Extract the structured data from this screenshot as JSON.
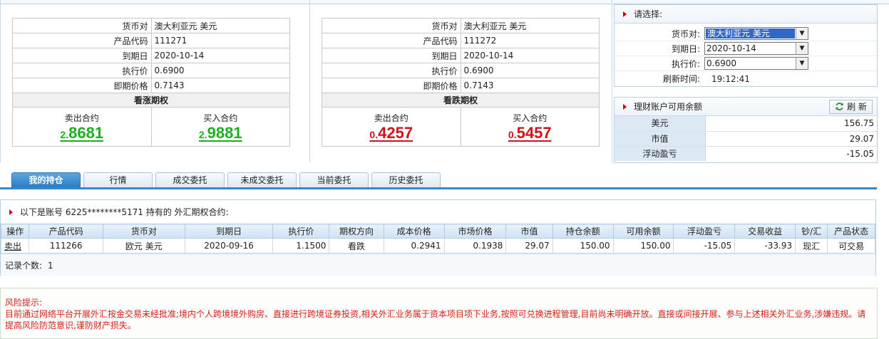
{
  "call_quote": {
    "rows": [
      {
        "label": "货币对",
        "value": "澳大利亚元 美元"
      },
      {
        "label": "产品代码",
        "value": "111271"
      },
      {
        "label": "到期日",
        "value": "2020-10-14"
      },
      {
        "label": "执行价",
        "value": "0.6900"
      },
      {
        "label": "即期价格",
        "value": "0.7143"
      }
    ],
    "header": "看涨期权",
    "sell_label": "卖出合约",
    "sell_prefix": "2.",
    "sell_price": "8681",
    "buy_label": "买入合约",
    "buy_prefix": "2.",
    "buy_price": "9881"
  },
  "put_quote": {
    "rows": [
      {
        "label": "货币对",
        "value": "澳大利亚元 美元"
      },
      {
        "label": "产品代码",
        "value": "111272"
      },
      {
        "label": "到期日",
        "value": "2020-10-14"
      },
      {
        "label": "执行价",
        "value": "0.6900"
      },
      {
        "label": "即期价格",
        "value": "0.7143"
      }
    ],
    "header": "看跌期权",
    "sell_label": "卖出合约",
    "sell_prefix": "0.",
    "sell_price": "4257",
    "buy_label": "买入合约",
    "buy_prefix": "0.",
    "buy_price": "5457"
  },
  "selector": {
    "title": "请选择:",
    "pair_label": "货币对:",
    "pair_value": "澳大利亚元 美元",
    "date_label": "到期日:",
    "date_value": "2020-10-14",
    "strike_label": "执行价:",
    "strike_value": "0.6900",
    "refresh_label": "刷新时间:",
    "refresh_time": "19:12:41"
  },
  "balance": {
    "title": "理财账户可用余额",
    "refresh_button": "刷 新",
    "rows": [
      {
        "label": "美元",
        "value": "156.75"
      },
      {
        "label": "市值",
        "value": "29.07"
      },
      {
        "label": "浮动盈亏",
        "value": "-15.05"
      }
    ]
  },
  "tabs": [
    "我的持仓",
    "行情",
    "成交委托",
    "未成交委托",
    "当前委托",
    "历史委托"
  ],
  "holdings": {
    "title": "以下是账号 6225********5171 持有的 外汇期权合约:",
    "columns": [
      "操作",
      "产品代码",
      "货币对",
      "到期日",
      "执行价",
      "期权方向",
      "成本价格",
      "市场价格",
      "市值",
      "持仓余额",
      "可用余额",
      "浮动盈亏",
      "交易收益",
      "钞/汇",
      "产品状态"
    ],
    "rows": [
      [
        "卖出",
        "111266",
        "欧元 美元",
        "2020-09-16",
        "1.1500",
        "看跌",
        "0.2941",
        "0.1938",
        "29.07",
        "150.00",
        "150.00",
        "-15.05",
        "-33.93",
        "现汇",
        "可交易"
      ]
    ],
    "record_label": "记录个数:",
    "record_count": "1"
  },
  "risk": {
    "title": "风险提示:",
    "text": "目前通过网络平台开展外汇按金交易未经批准;境内个人跨境境外购房、直接进行跨境证券投资,相关外汇业务属于资本项目项下业务,按照可兑换进程管理,目前尚未明确开放。直接或间接开展、参与上述相关外汇业务,涉嫌违规。请提高风险防范意识,谨防财产损失。"
  },
  "colors": {
    "call": "#1db01d",
    "put": "#d0121a",
    "tab_active": "#2a7cc3",
    "risk_text": "#d2201a"
  }
}
